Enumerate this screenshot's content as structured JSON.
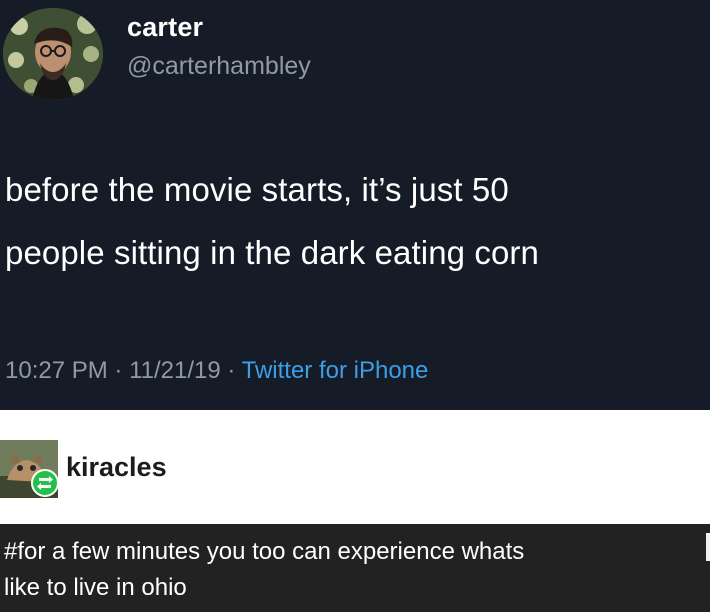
{
  "tweet": {
    "display_name": "carter",
    "handle": "@carterhambley",
    "text_line1": "before the movie starts, it’s just 50",
    "text_line2": "people sitting in the dark eating corn",
    "time": "10:27 PM",
    "date": "11/21/19",
    "separator": "·",
    "source": "Twitter for iPhone",
    "avatar_icon": "profile-photo-icon"
  },
  "reblog": {
    "username": "kiracles",
    "avatar_icon": "profile-photo-icon",
    "badge_icon": "reblog-icon",
    "tags_line1": "#for a few minutes you too can experience whats",
    "tags_line2": "like to live in ohio"
  },
  "colors": {
    "tweet_bg": "#161c27",
    "link_blue": "#3d9ee8",
    "meta_gray": "#8f9aa6",
    "reblog_bg": "#ffffff",
    "tag_bg": "#222222",
    "reblog_badge_green": "#23c14a"
  }
}
